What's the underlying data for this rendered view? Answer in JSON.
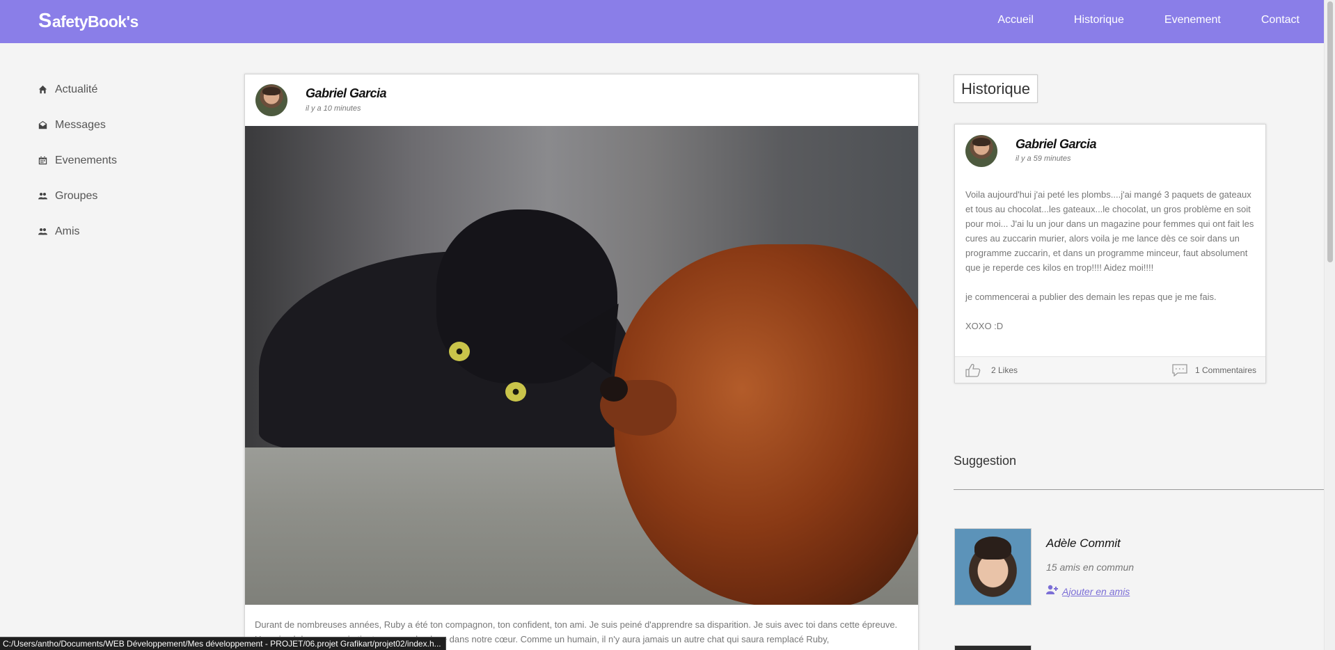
{
  "brand": {
    "name": "afetyBook's",
    "initial": "S"
  },
  "nav": {
    "items": [
      "Accueil",
      "Historique",
      "Evenement",
      "Contact"
    ]
  },
  "sidebar": {
    "items": [
      {
        "label": "Actualité",
        "icon": "home-icon"
      },
      {
        "label": "Messages",
        "icon": "envelope-icon"
      },
      {
        "label": "Evenements",
        "icon": "calendar-icon"
      },
      {
        "label": "Groupes",
        "icon": "users-icon"
      },
      {
        "label": "Amis",
        "icon": "users-icon"
      }
    ]
  },
  "post": {
    "author": "Gabriel Garcia",
    "time": "il y a 10 minutes",
    "text": "Durant de nombreuses années, Ruby a été ton compagnon, ton confident, ton ami. Je suis peiné d'apprendre sa disparition. Je suis avec toi dans cette épreuve. Un animal de compagnie tient une grande place dans notre cœur. Comme un humain, il n'y aura jamais un autre chat qui saura remplacé Ruby,"
  },
  "historique": {
    "title": "Historique",
    "author": "Gabriel Garcia",
    "time": "il y a 59 minutes",
    "paragraphs": [
      "Voila aujourd'hui j'ai peté les plombs....j'ai mangé 3 paquets de gateaux et tous au chocolat...les gateaux...le chocolat, un gros problème en soit pour moi... J'ai lu un jour dans un magazine pour femmes qui ont fait les cures au zuccarin murier, alors voila je me lance dès ce soir dans un programme zuccarin, et dans un programme minceur, faut absolument que je reperde ces kilos en trop!!!! Aidez moi!!!!",
      "je commencerai a publier des demain les repas que je me fais.",
      "XOXO :D"
    ],
    "likes": "2 Likes",
    "comments": "1 Commentaires"
  },
  "suggestion": {
    "title": "Suggestion",
    "name": "Adèle Commit",
    "common": "15 amis en commun",
    "add_label": "Ajouter en amis"
  },
  "statusbar": {
    "text": "C:/Users/antho/Documents/WEB Développement/Mes développement - PROJET/06.projet Grafikart/projet02/index.h..."
  },
  "colors": {
    "navbar": "#8a7ee8",
    "accent": "#7b6ed6"
  }
}
